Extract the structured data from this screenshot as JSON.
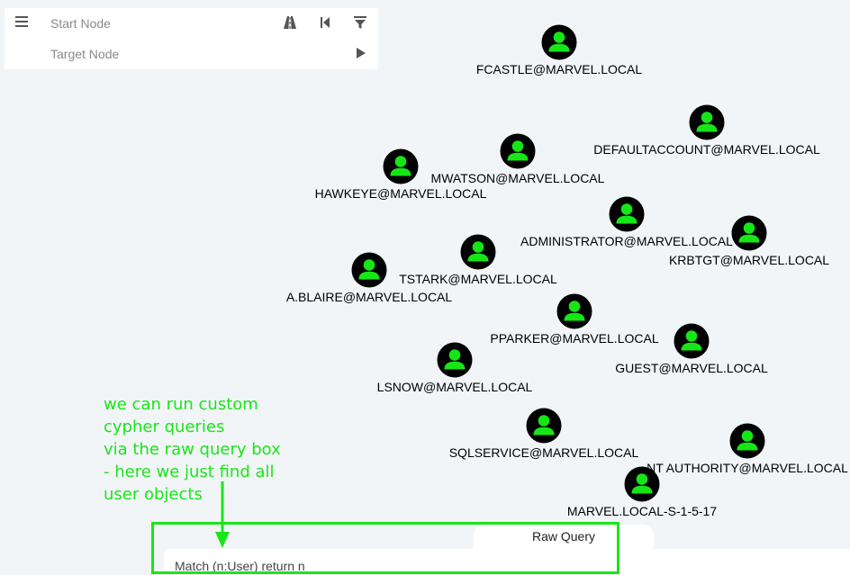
{
  "search": {
    "start_placeholder": "Start Node",
    "target_placeholder": "Target Node",
    "icons": {
      "menu": "hamburger-menu-icon",
      "pathfinding": "road-icon",
      "back": "skip-back-icon",
      "filter": "filter-icon",
      "play": "play-icon"
    }
  },
  "graph": {
    "node_color": "#16e616",
    "node_background": "#000000",
    "nodes": [
      {
        "label": "FCASTLE@MARVEL.LOCAL"
      },
      {
        "label": "DEFAULTACCOUNT@MARVEL.LOCAL"
      },
      {
        "label": "MWATSON@MARVEL.LOCAL"
      },
      {
        "label": "HAWKEYE@MARVEL.LOCAL"
      },
      {
        "label": "ADMINISTRATOR@MARVEL.LOCAL"
      },
      {
        "label": "KRBTGT@MARVEL.LOCAL"
      },
      {
        "label": "TSTARK@MARVEL.LOCAL"
      },
      {
        "label": "A.BLAIRE@MARVEL.LOCAL"
      },
      {
        "label": "PPARKER@MARVEL.LOCAL"
      },
      {
        "label": "GUEST@MARVEL.LOCAL"
      },
      {
        "label": "LSNOW@MARVEL.LOCAL"
      },
      {
        "label": "SQLSERVICE@MARVEL.LOCAL"
      },
      {
        "label": "NT AUTHORITY@MARVEL.LOCAL"
      },
      {
        "label": "MARVEL.LOCAL-S-1-5-17"
      }
    ]
  },
  "annotation": {
    "color": "#19e619",
    "lines": [
      "we can run custom",
      "cypher queries",
      "via the raw query box",
      "- here we just find all",
      "user objects"
    ]
  },
  "raw_query": {
    "tab_label": "Raw Query",
    "value": "Match (n:User) return n"
  }
}
